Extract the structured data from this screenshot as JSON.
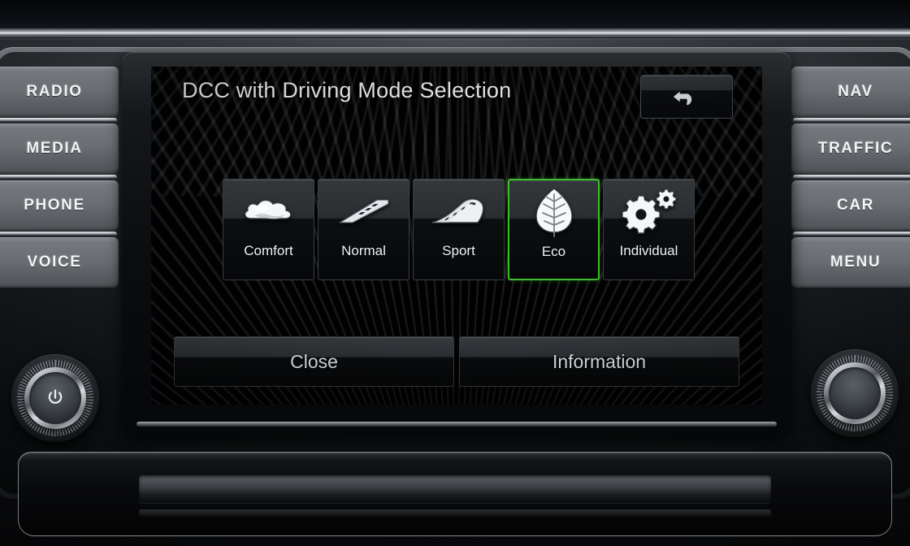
{
  "device": {
    "name": "car-infotainment-head-unit"
  },
  "left_keys": [
    {
      "label": "RADIO",
      "name": "hardkey-radio"
    },
    {
      "label": "MEDIA",
      "name": "hardkey-media"
    },
    {
      "label": "PHONE",
      "name": "hardkey-phone"
    },
    {
      "label": "VOICE",
      "name": "hardkey-voice"
    }
  ],
  "right_keys": [
    {
      "label": "NAV",
      "name": "hardkey-nav"
    },
    {
      "label": "TRAFFIC",
      "name": "hardkey-traffic"
    },
    {
      "label": "CAR",
      "name": "hardkey-car"
    },
    {
      "label": "MENU",
      "name": "hardkey-menu"
    }
  ],
  "knobs": {
    "left": {
      "icon": "power-icon",
      "label": "power-volume-knob"
    },
    "right": {
      "icon": "none",
      "label": "tune-scroll-knob"
    }
  },
  "screen": {
    "header": {
      "title": "DCC with Driving Mode Selection",
      "back_button_icon": "back-arrow-icon"
    },
    "modes": [
      {
        "label": "Comfort",
        "icon": "cloud-icon",
        "selected": false
      },
      {
        "label": "Normal",
        "icon": "flat-road-icon",
        "selected": false
      },
      {
        "label": "Sport",
        "icon": "curved-road-icon",
        "selected": false
      },
      {
        "label": "Eco",
        "icon": "leaf-icon",
        "selected": true
      },
      {
        "label": "Individual",
        "icon": "gears-icon",
        "selected": false
      }
    ],
    "actions": [
      {
        "label": "Close",
        "name": "close-button"
      },
      {
        "label": "Information",
        "name": "information-button"
      }
    ]
  },
  "colors": {
    "selection_green": "#3fbb2e",
    "screen_black": "#010102",
    "key_gray": "#6a6e72",
    "text_white": "#f2f4f6"
  }
}
